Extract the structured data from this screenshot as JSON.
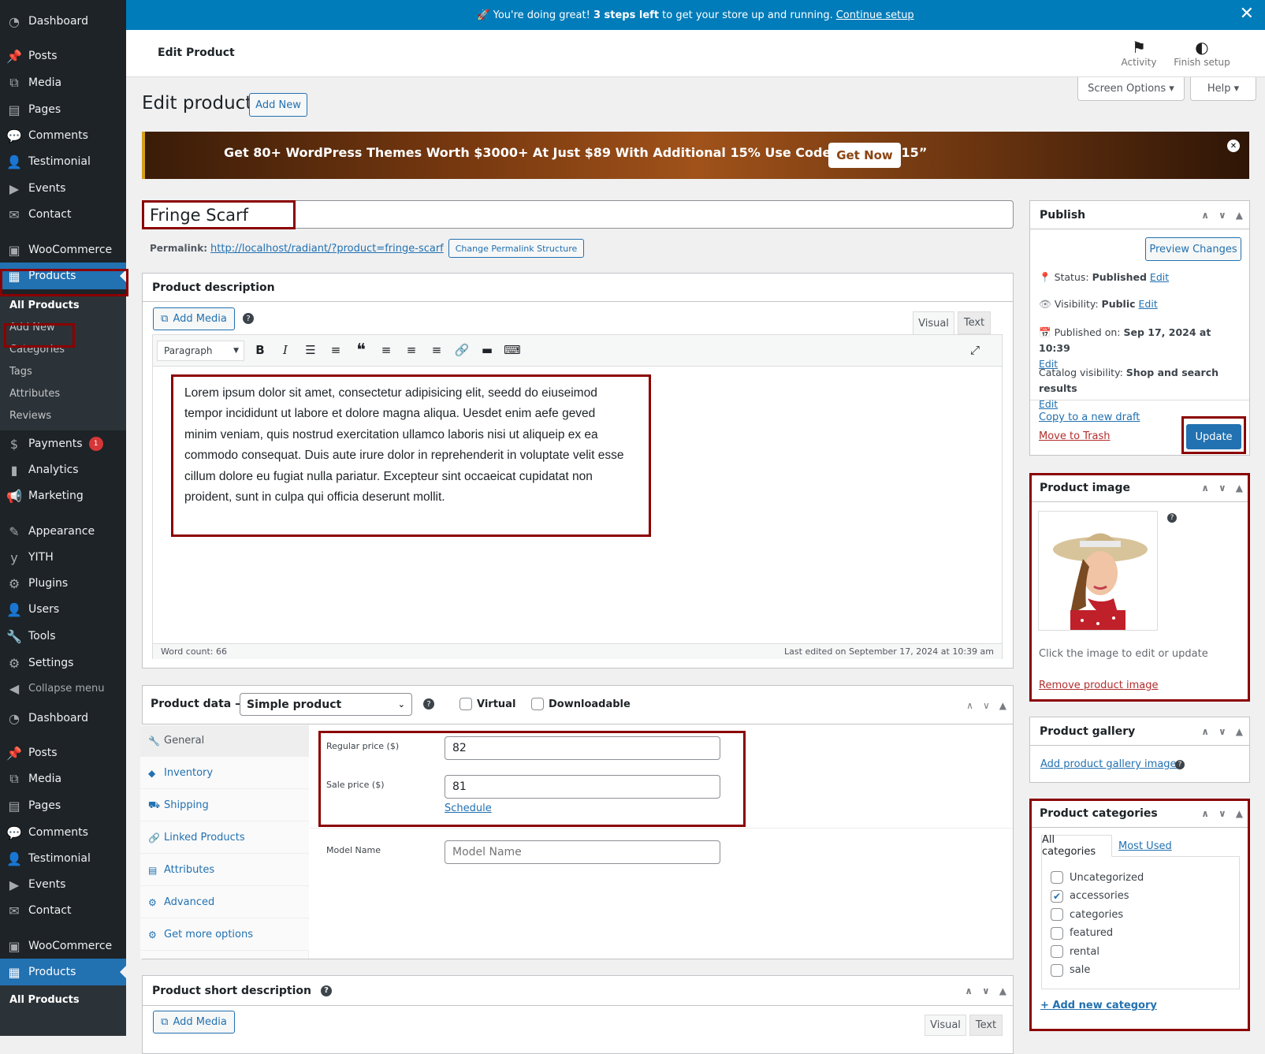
{
  "sidebar": {
    "items_top": [
      {
        "label": "Dashboard",
        "icon": "dashboard-icon"
      },
      {
        "label": "Posts",
        "icon": "pin-icon"
      },
      {
        "label": "Media",
        "icon": "media-icon"
      },
      {
        "label": "Pages",
        "icon": "pages-icon"
      },
      {
        "label": "Comments",
        "icon": "comment-icon"
      },
      {
        "label": "Testimonial",
        "icon": "user-icon"
      },
      {
        "label": "Events",
        "icon": "video-icon"
      },
      {
        "label": "Contact",
        "icon": "email-icon"
      },
      {
        "label": "WooCommerce",
        "icon": "woo-icon"
      },
      {
        "label": "Products",
        "icon": "archive-icon"
      }
    ],
    "submenu": [
      "All Products",
      "Add New",
      "Categories",
      "Tags",
      "Attributes",
      "Reviews"
    ],
    "items_mid": [
      {
        "label": "Payments",
        "icon": "payment-icon",
        "badge": "1"
      },
      {
        "label": "Analytics",
        "icon": "chart-icon"
      },
      {
        "label": "Marketing",
        "icon": "megaphone-icon"
      },
      {
        "label": "Appearance",
        "icon": "brush-icon"
      },
      {
        "label": "YITH",
        "icon": "yith-icon"
      },
      {
        "label": "Plugins",
        "icon": "plugin-icon"
      },
      {
        "label": "Users",
        "icon": "user-icon"
      },
      {
        "label": "Tools",
        "icon": "wrench-icon"
      },
      {
        "label": "Settings",
        "icon": "settings-icon"
      },
      {
        "label": "Collapse menu",
        "icon": "collapse-icon"
      },
      {
        "label": "Dashboard",
        "icon": "dashboard-icon"
      },
      {
        "label": "Posts",
        "icon": "pin-icon"
      },
      {
        "label": "Media",
        "icon": "media-icon"
      },
      {
        "label": "Pages",
        "icon": "pages-icon"
      },
      {
        "label": "Comments",
        "icon": "comment-icon"
      },
      {
        "label": "Testimonial",
        "icon": "user-icon"
      },
      {
        "label": "Events",
        "icon": "video-icon"
      },
      {
        "label": "Contact",
        "icon": "email-icon"
      },
      {
        "label": "WooCommerce",
        "icon": "woo-icon"
      },
      {
        "label": "Products",
        "icon": "archive-icon"
      }
    ],
    "bottom_sub": "All Products"
  },
  "notice": {
    "emoji": "🚀",
    "text1": "You're doing great!",
    "strong": "3 steps left",
    "text2": "to get your store up and running.",
    "link": "Continue setup"
  },
  "topbar": {
    "title": "Edit Product",
    "activity": "Activity",
    "finish": "Finish setup"
  },
  "screen_options": "Screen Options ▾",
  "help": "Help ▾",
  "heading": "Edit product",
  "add_new": "Add New",
  "banner": {
    "text": "Get 80+ WordPress Themes Worth $3000+ At Just $89 With Additional 15% Use Code “MagBun15”",
    "button": "Get Now"
  },
  "product_title": "Fringe Scarf",
  "permalink": {
    "label": "Permalink:",
    "url": "http://localhost/radiant/?product=fringe-scarf",
    "button": "Change Permalink Structure"
  },
  "description": {
    "title": "Product description",
    "add_media": "Add Media",
    "tab_visual": "Visual",
    "tab_text": "Text",
    "format": "Paragraph",
    "lines": [
      "Lorem ipsum dolor sit amet, consectetur adipisicing elit, seedd do eiuseimod",
      "tempor incididunt ut labore et dolore magna aliqua. Uesdet enim aefe geved",
      "minim veniam, quis nostrud exercitation ullamco laboris nisi ut aliqueip ex ea",
      "commodo consequat. Duis aute irure dolor in reprehenderit in voluptate velit esse",
      "cillum dolore eu fugiat nulla pariatur. Excepteur sint occaeicat cupidatat non",
      "proident, sunt in culpa qui officia deserunt mollit."
    ],
    "word_count": "Word count: 66",
    "last_edited": "Last edited on September 17, 2024 at 10:39 am"
  },
  "product_data": {
    "title": "Product data —",
    "type": "Simple product",
    "virtual": "Virtual",
    "downloadable": "Downloadable",
    "tabs": [
      {
        "label": "General",
        "icon": "wrench-icon"
      },
      {
        "label": "Inventory",
        "icon": "tag-icon"
      },
      {
        "label": "Shipping",
        "icon": "truck-icon"
      },
      {
        "label": "Linked Products",
        "icon": "link-icon"
      },
      {
        "label": "Attributes",
        "icon": "list-icon"
      },
      {
        "label": "Advanced",
        "icon": "gear-icon"
      },
      {
        "label": "Get more options",
        "icon": "plugin-icon"
      }
    ],
    "regular_label": "Regular price ($)",
    "regular_value": "82",
    "sale_label": "Sale price ($)",
    "sale_value": "81",
    "schedule": "Schedule",
    "model_label": "Model Name",
    "model_placeholder": "Model Name"
  },
  "short_desc": {
    "title": "Product short description",
    "add_media": "Add Media",
    "tab_visual": "Visual",
    "tab_text": "Text"
  },
  "publish": {
    "title": "Publish",
    "preview": "Preview Changes",
    "status_label": "Status:",
    "status": "Published",
    "visibility_label": "Visibility:",
    "visibility": "Public",
    "published_label": "Published on:",
    "published": "Sep 17, 2024 at 10:39",
    "catalog_label": "Catalog visibility:",
    "catalog": "Shop and search results",
    "edit": "Edit",
    "copy": "Copy to a new draft",
    "trash": "Move to Trash",
    "update": "Update"
  },
  "product_image": {
    "title": "Product image",
    "hint": "Click the image to edit or update",
    "remove": "Remove product image"
  },
  "gallery": {
    "title": "Product gallery",
    "add": "Add product gallery images"
  },
  "categories": {
    "title": "Product categories",
    "tab_all": "All categories",
    "tab_used": "Most Used",
    "items": [
      {
        "label": "Uncategorized",
        "checked": false
      },
      {
        "label": "accessories",
        "checked": true
      },
      {
        "label": "categories",
        "checked": false
      },
      {
        "label": "featured",
        "checked": false
      },
      {
        "label": "rental",
        "checked": false
      },
      {
        "label": "sale",
        "checked": false
      }
    ],
    "add": "+ Add new category"
  },
  "colors": {
    "sidebar": "#1d2327",
    "accent": "#2271b1",
    "notice": "#007cba",
    "highlight": "#8b0000",
    "trash": "#b32d2e"
  }
}
